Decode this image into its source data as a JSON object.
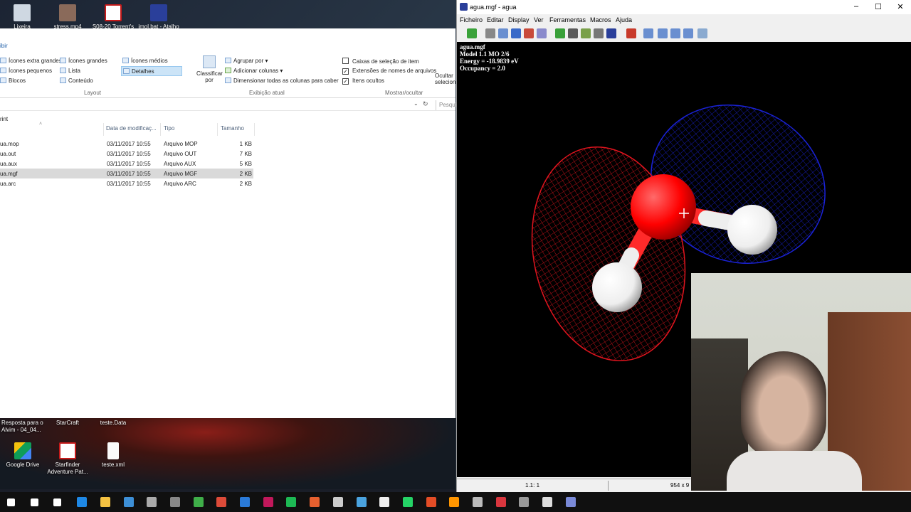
{
  "desktop": {
    "top_icons": [
      {
        "label": "Lixeira"
      },
      {
        "label": "stress.mp4"
      },
      {
        "label": "S08-20 Torrent's"
      },
      {
        "label": "jmol.bat - Atalho"
      }
    ],
    "bottom_labels": [
      {
        "label": "Resposta para o Alvim - 04_04..."
      },
      {
        "label": "StarCraft"
      },
      {
        "label": "teste.Data"
      }
    ],
    "bottom_icons": [
      {
        "label": "Google Drive"
      },
      {
        "label": "Starfinder Adventure Pat..."
      },
      {
        "label": "teste.xml"
      }
    ]
  },
  "explorer": {
    "tab_label": "ibir",
    "ribbon": {
      "layout_items": [
        "Ícones extra grandes",
        "Ícones grandes",
        "Ícones médios",
        "Ícones pequenos",
        "Lista",
        "Detalhes",
        "Blocos",
        "Conteúdo"
      ],
      "layout_group": "Layout",
      "sort_label": "Classificar por",
      "group_by": "Agrupar por",
      "add_columns": "Adicionar colunas",
      "size_columns": "Dimensionar todas as colunas para caber",
      "view_group": "Exibição atual",
      "checkboxes": [
        {
          "label": "Caixas de seleção de item",
          "checked": false
        },
        {
          "label": "Extensões de nomes de arquivos",
          "checked": true
        },
        {
          "label": "Itens ocultos",
          "checked": true
        }
      ],
      "show_group": "Mostrar/ocultar",
      "hide_selected": "Ocultar selecion"
    },
    "address_tail": "rint",
    "search_placeholder": "Pesqui",
    "columns": [
      "Data de modificaç...",
      "Tipo",
      "Tamanho"
    ],
    "files": [
      {
        "name": "ua.mop",
        "date": "03/11/2017 10:55",
        "type": "Arquivo MOP",
        "size": "1 KB",
        "selected": false
      },
      {
        "name": "ua.out",
        "date": "03/11/2017 10:55",
        "type": "Arquivo OUT",
        "size": "7 KB",
        "selected": false
      },
      {
        "name": "ua.aux",
        "date": "03/11/2017 10:55",
        "type": "Arquivo AUX",
        "size": "5 KB",
        "selected": false
      },
      {
        "name": "ua.mgf",
        "date": "03/11/2017 10:55",
        "type": "Arquivo MGF",
        "size": "2 KB",
        "selected": true
      },
      {
        "name": "ua.arc",
        "date": "03/11/2017 10:55",
        "type": "Arquivo ARC",
        "size": "2 KB",
        "selected": false
      }
    ]
  },
  "jmol": {
    "title": "agua.mgf - agua",
    "menus": [
      "Ficheiro",
      "Editar",
      "Display",
      "Ver",
      "Ferramentas",
      "Macros",
      "Ajuda"
    ],
    "info_lines": [
      "agua.mgf",
      "Model 1.1  MO 2/6",
      "Energy = -18.9839 eV",
      "Occupancy = 2.0"
    ],
    "status_left": "1.1: 1",
    "status_right": "954 x 9",
    "colors": {
      "lobe_positive": "#e0141e",
      "lobe_negative": "#1a22d8",
      "oxygen": "#ff0000",
      "hydrogen": "#ffffff"
    }
  },
  "taskbar": {
    "icons": [
      "windows-icon",
      "search-icon",
      "task-view-icon",
      "edge-icon",
      "file-explorer-icon",
      "store-icon",
      "tools-icon",
      "game-icon",
      "app-icon",
      "chrome-icon",
      "app2-icon",
      "app3-icon",
      "spotify-icon",
      "app4-icon",
      "steam-icon",
      "app5-icon",
      "mail-icon",
      "whatsapp-icon",
      "app6-icon",
      "firefox-icon",
      "app7-icon",
      "app8-icon",
      "app9-icon",
      "terminal-icon",
      "jmol-icon"
    ]
  }
}
